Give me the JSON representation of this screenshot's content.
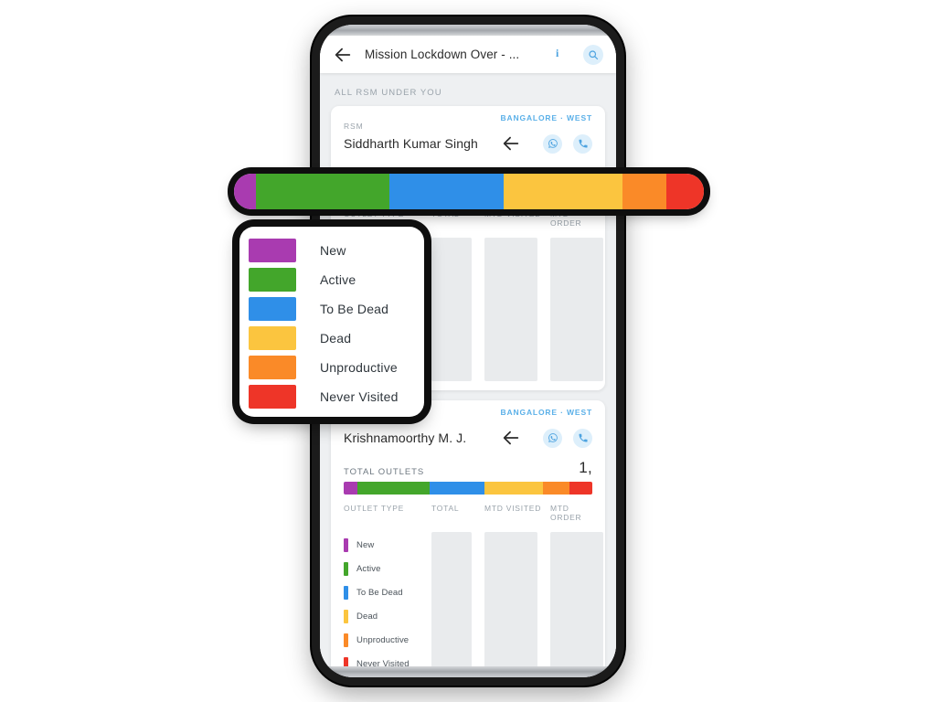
{
  "app_bar": {
    "back_icon": "back-arrow-icon",
    "title": "Mission Lockdown Over - ...",
    "info_icon_label": "i",
    "info_icon": "info-icon",
    "search_icon": "search-icon"
  },
  "section": {
    "label": "ALL RSM UNDER YOU"
  },
  "table_headers": {
    "outlet_type": "OUTLET TYPE",
    "total": "TOTAL",
    "mtd_visited": "MTD VISITED",
    "mtd_order": "MTD ORDER"
  },
  "labels": {
    "rsm": "RSM",
    "total_outlets": "TOTAL OUTLETS"
  },
  "colors": {
    "new": "#A93BB0",
    "active": "#43A62B",
    "to_be_dead": "#2F8FE8",
    "dead": "#FBC53F",
    "unproductive": "#FA8A28",
    "never_visited": "#EE3528",
    "accent_blue": "#4DA3E0",
    "icon_bg": "#DDEFFB",
    "screen_bg": "#EEF0F2",
    "card_bg": "#FFFFFF",
    "skeleton": "#E9EBED"
  },
  "legend": [
    {
      "label": "New",
      "color": "#A93BB0"
    },
    {
      "label": "Active",
      "color": "#43A62B"
    },
    {
      "label": "To Be Dead",
      "color": "#2F8FE8"
    },
    {
      "label": "Dead",
      "color": "#FBC53F"
    },
    {
      "label": "Unproductive",
      "color": "#FA8A28"
    },
    {
      "label": "Never Visited",
      "color": "#EE3528"
    }
  ],
  "cards": [
    {
      "region": "BANGALORE · WEST",
      "rsm_label": "RSM",
      "name": "Siddharth Kumar Singh",
      "total_outlets_label": "TOTAL OUTLETS",
      "total_outlets_value": "1,",
      "chart_data": {
        "type": "bar",
        "title": "TOTAL OUTLETS",
        "categories": [
          "New",
          "Active",
          "To Be Dead",
          "Dead",
          "Unproductive",
          "Never Visited"
        ],
        "values": [
          4.7,
          28.4,
          24.3,
          25.2,
          9.5,
          7.9
        ],
        "unit": "percent",
        "colors": [
          "#A93BB0",
          "#43A62B",
          "#2F8FE8",
          "#FBC53F",
          "#FA8A28",
          "#EE3528"
        ],
        "stacked": true,
        "legend_position": "left-column"
      }
    },
    {
      "region": "BANGALORE · WEST",
      "rsm_label": "RSM",
      "name": "Krishnamoorthy M. J.",
      "total_outlets_label": "TOTAL OUTLETS",
      "total_outlets_value": "1,",
      "chart_data": {
        "type": "bar",
        "title": "TOTAL OUTLETS",
        "categories": [
          "New",
          "Active",
          "To Be Dead",
          "Dead",
          "Unproductive",
          "Never Visited"
        ],
        "values": [
          5.5,
          29.0,
          22.0,
          23.5,
          11.0,
          9.0
        ],
        "unit": "percent",
        "colors": [
          "#A93BB0",
          "#43A62B",
          "#2F8FE8",
          "#FBC53F",
          "#FA8A28",
          "#EE3528"
        ],
        "stacked": true,
        "legend_position": "left-column"
      }
    }
  ],
  "bar_callout": {
    "name": "magnified-stacked-bar",
    "segments": [
      {
        "label": "New",
        "color": "#A93BB0",
        "pct": 4.7
      },
      {
        "label": "Active",
        "color": "#43A62B",
        "pct": 28.4
      },
      {
        "label": "To Be Dead",
        "color": "#2F8FE8",
        "pct": 24.3
      },
      {
        "label": "Dead",
        "color": "#FBC53F",
        "pct": 25.2
      },
      {
        "label": "Unproductive",
        "color": "#FA8A28",
        "pct": 9.5
      },
      {
        "label": "Never Visited",
        "color": "#EE3528",
        "pct": 7.9
      }
    ]
  }
}
